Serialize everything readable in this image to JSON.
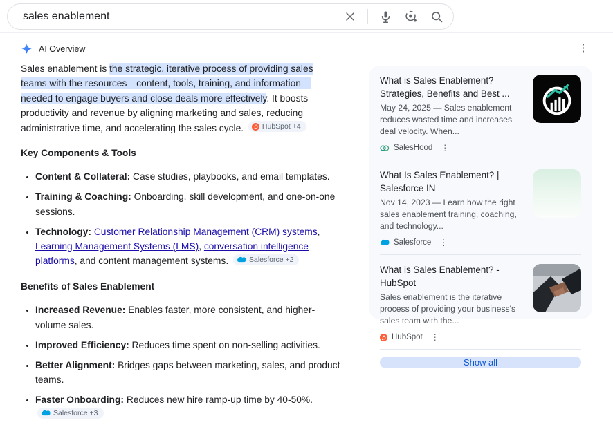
{
  "theme": {
    "highlight": "#d3e3fd",
    "link": "#1a0dab",
    "chip_bg": "#f0f3fa",
    "panel_bg": "#f7f9fd",
    "show_all_bg": "#d7e3fb",
    "show_all_text": "#0b57d0",
    "hubspot_orange": "#ff5c35",
    "salesforce_blue": "#00a1e0",
    "saleshood_teal": "#0e9384",
    "sparkle_blue": "#4285f4"
  },
  "search": {
    "query": "sales enablement",
    "icons": [
      "clear-icon",
      "voice-search-icon",
      "lens-icon",
      "search-icon"
    ]
  },
  "overview": {
    "title": "AI Overview",
    "menu_icon": "kebab-menu-icon",
    "intro": {
      "plain_start": "Sales enablement is ",
      "highlighted": "the strategic, iterative process of providing sales teams with the resources—content, tools, training, and information—needed to engage buyers and close deals more effectively",
      "plain_end": ". It boosts productivity and revenue by aligning marketing and sales, reducing administrative time, and accelerating the sales cycle.",
      "chip": {
        "label": "HubSpot +4",
        "icon": "hubspot"
      }
    },
    "sections": [
      {
        "heading": "Key Components & Tools",
        "bullets": [
          {
            "segments": [
              {
                "t": "bold",
                "text": "Content & Collateral:"
              },
              {
                "t": "text",
                "text": " Case studies, playbooks, and email templates."
              }
            ]
          },
          {
            "segments": [
              {
                "t": "bold",
                "text": "Training & Coaching:"
              },
              {
                "t": "text",
                "text": " Onboarding, skill development, and one-on-one sessions."
              }
            ]
          },
          {
            "segments": [
              {
                "t": "bold",
                "text": "Technology:"
              },
              {
                "t": "text",
                "text": " "
              },
              {
                "t": "link",
                "text": "Customer Relationship Management (CRM) systems"
              },
              {
                "t": "text",
                "text": ", "
              },
              {
                "t": "link",
                "text": "Learning Management Systems (LMS)"
              },
              {
                "t": "text",
                "text": ", "
              },
              {
                "t": "link",
                "text": "conversation intelligence platforms"
              },
              {
                "t": "text",
                "text": ", and content management systems. "
              },
              {
                "t": "chip",
                "label": "Salesforce +2",
                "icon": "salesforce"
              }
            ]
          }
        ]
      },
      {
        "heading": "Benefits of Sales Enablement",
        "bullets": [
          {
            "segments": [
              {
                "t": "bold",
                "text": "Increased Revenue:"
              },
              {
                "t": "text",
                "text": " Enables faster, more consistent, and higher-volume sales."
              }
            ]
          },
          {
            "segments": [
              {
                "t": "bold",
                "text": "Improved Efficiency:"
              },
              {
                "t": "text",
                "text": " Reduces time spent on non-selling activities."
              }
            ]
          },
          {
            "segments": [
              {
                "t": "bold",
                "text": "Better Alignment:"
              },
              {
                "t": "text",
                "text": " Bridges gaps between marketing, sales, and product teams."
              }
            ]
          },
          {
            "segments": [
              {
                "t": "bold",
                "text": "Faster Onboarding:"
              },
              {
                "t": "text",
                "text": " Reduces new hire ramp-up time by 40-50%. "
              },
              {
                "t": "chip",
                "label": "Salesforce +3",
                "icon": "salesforce"
              }
            ]
          }
        ]
      }
    ]
  },
  "results": {
    "cards": [
      {
        "title": "What is Sales Enablement? Strategies, Benefits and Best ...",
        "snippet": "May 24, 2025 — Sales enablement reduces wasted time and increases deal velocity. When...",
        "source": "SalesHood",
        "source_icon": "saleshood",
        "thumb": "chart",
        "thumb_name": "bar-chart-logo-thumbnail"
      },
      {
        "title": "What Is Sales Enablement? | Salesforce IN",
        "snippet": "Nov 14, 2023 — Learn how the right sales enablement training, coaching, and technology...",
        "source": "Salesforce",
        "source_icon": "salesforce",
        "thumb": "mint",
        "thumb_name": "mint-gradient-thumbnail"
      },
      {
        "title": "What is Sales Enablement? - HubSpot",
        "snippet": "Sales enablement is the iterative process of providing your business's sales team with the...",
        "source": "HubSpot",
        "source_icon": "hubspot",
        "thumb": "handshake",
        "thumb_name": "handshake-photo-thumbnail"
      }
    ],
    "show_all_label": "Show all"
  }
}
